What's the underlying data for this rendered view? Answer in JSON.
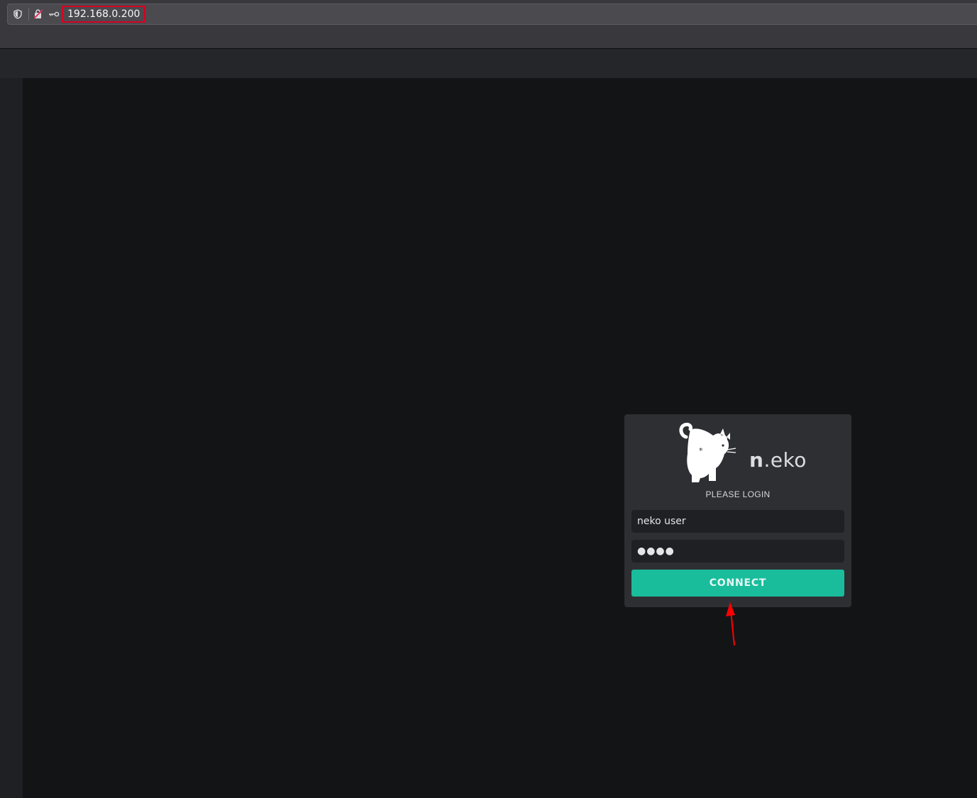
{
  "browser": {
    "url": "192.168.0.200",
    "icons": [
      "shield-icon",
      "blocked-permission-icon",
      "key-icon"
    ]
  },
  "login": {
    "brand_bold": "n",
    "brand_rest": ".eko",
    "heading": "PLEASE LOGIN",
    "username_value": "neko user",
    "password_value": "●●●●",
    "connect_label": "CONNECT"
  },
  "colors": {
    "accent": "#19bd9c",
    "annotation": "#ff0000",
    "url_highlight": "#d70022"
  }
}
